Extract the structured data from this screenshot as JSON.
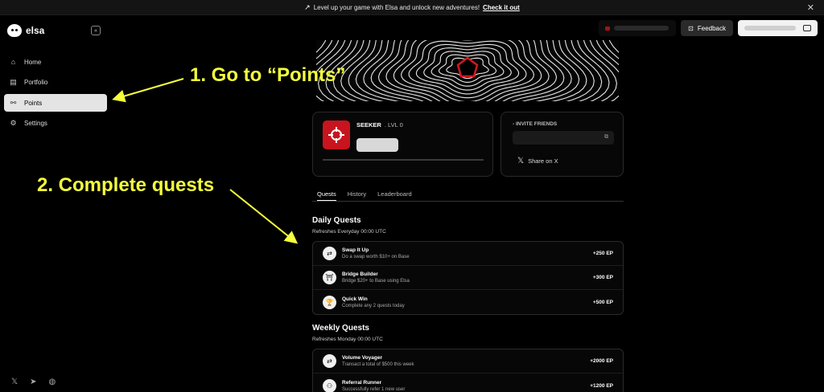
{
  "banner": {
    "text": "Level up your game with Elsa and unlock new adventures!",
    "cta": "Check it out",
    "close": "✕"
  },
  "app": {
    "name": "elsa"
  },
  "sidebar": {
    "collapse_icon": "«",
    "items": [
      {
        "label": "Home",
        "icon": "home-icon",
        "glyph": "⌂"
      },
      {
        "label": "Portfolio",
        "icon": "portfolio-icon",
        "glyph": "▤"
      },
      {
        "label": "Points",
        "icon": "points-icon",
        "glyph": "⚯"
      },
      {
        "label": "Settings",
        "icon": "settings-icon",
        "glyph": "⚙"
      }
    ],
    "social": [
      "𝕏",
      "➤",
      "◍"
    ]
  },
  "header": {
    "feedback_label": "Feedback"
  },
  "profile": {
    "rank": "SEEKER",
    "level": ". LVL 0"
  },
  "invite": {
    "label": "- INVITE FRIENDS",
    "share_label": "Share on X"
  },
  "tabs": [
    "Quests",
    "History",
    "Leaderboard"
  ],
  "daily": {
    "title": "Daily Quests",
    "subtitle": "Refreshes Everyday 00:00 UTC",
    "quests": [
      {
        "name": "Swap It Up",
        "desc": "Do a swap worth $10+ on Base",
        "points": "+250 EP",
        "glyph": "⇄"
      },
      {
        "name": "Bridge Builder",
        "desc": "Bridge $20+ to Base using Elsa",
        "points": "+300 EP",
        "glyph": "⛩"
      },
      {
        "name": "Quick Win",
        "desc": "Complete any 2 quests today",
        "points": "+500 EP",
        "glyph": "🏆"
      }
    ]
  },
  "weekly": {
    "title": "Weekly Quests",
    "subtitle": "Refreshes Monday 00:00 UTC",
    "quests": [
      {
        "name": "Volume Voyager",
        "desc": "Transact a total of $500 this week",
        "points": "+2000 EP",
        "glyph": "⇄"
      },
      {
        "name": "Referral Runner",
        "desc": "Successfully refer 1 new user",
        "points": "+1200 EP",
        "glyph": "⚇"
      }
    ]
  },
  "annotations": {
    "step1": "1. Go to  “Points”",
    "step2": "2. Complete quests"
  },
  "colors": {
    "accent_red": "#c8141e",
    "annotation_yellow": "#f5ff3c"
  }
}
